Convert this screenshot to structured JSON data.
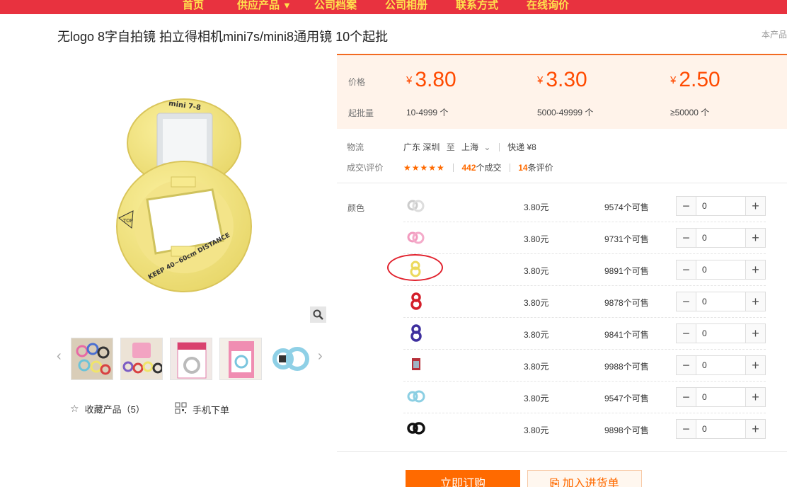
{
  "nav": {
    "items": [
      {
        "label": "首页"
      },
      {
        "label": "供应产品",
        "arrow": "▼"
      },
      {
        "label": "公司档案"
      },
      {
        "label": "公司相册"
      },
      {
        "label": "联系方式"
      },
      {
        "label": "在线询价"
      }
    ]
  },
  "product": {
    "title": "无logo 8字自拍镜 拍立得相机mini7s/mini8通用镜 10个起批",
    "corner_link": "本产品"
  },
  "pricing": {
    "price_label": "价格",
    "moq_label": "起批量",
    "currency": "¥",
    "tiers": [
      {
        "price": "3.80",
        "qty": "10-4999 个"
      },
      {
        "price": "3.30",
        "qty": "5000-49999 个"
      },
      {
        "price": "2.50",
        "qty": "≥50000 个"
      }
    ]
  },
  "logistics": {
    "label": "物流",
    "from": "广东 深圳",
    "to_word": "至",
    "to": "上海",
    "express": "快递 ¥8"
  },
  "reviews": {
    "label": "成交\\评价",
    "stars": "★★★★★",
    "deals_num": "442",
    "deals_suffix": "个成交",
    "reviews_num": "14",
    "reviews_suffix": "条评价"
  },
  "sku": {
    "color_label": "颜色",
    "rows": [
      {
        "swatch": "white",
        "price": "3.80元",
        "stock": "9574个可售",
        "qty": "0"
      },
      {
        "swatch": "pink",
        "price": "3.80元",
        "stock": "9731个可售",
        "qty": "0"
      },
      {
        "swatch": "yellow",
        "price": "3.80元",
        "stock": "9891个可售",
        "qty": "0"
      },
      {
        "swatch": "red",
        "price": "3.80元",
        "stock": "9878个可售",
        "qty": "0"
      },
      {
        "swatch": "purple",
        "price": "3.80元",
        "stock": "9841个可售",
        "qty": "0"
      },
      {
        "swatch": "package",
        "price": "3.80元",
        "stock": "9988个可售",
        "qty": "0"
      },
      {
        "swatch": "blue",
        "price": "3.80元",
        "stock": "9547个可售",
        "qty": "0"
      },
      {
        "swatch": "black",
        "price": "3.80元",
        "stock": "9898个可售",
        "qty": "0"
      }
    ],
    "minus": "−",
    "plus": "+"
  },
  "gallery": {
    "favorite_label": "收藏产品（5）",
    "mobile_label": "手机下单",
    "lens_top_text": "mini 7-8",
    "lens_side_text": "KEEP 40~60cm DISTANCE",
    "lens_badge": "TOP"
  },
  "actions": {
    "buy": "立即订购",
    "cart": "加入进货单"
  },
  "colors": {
    "accent": "#ff6a00",
    "nav_bg": "#e8323f",
    "nav_text": "#ffe14d"
  }
}
